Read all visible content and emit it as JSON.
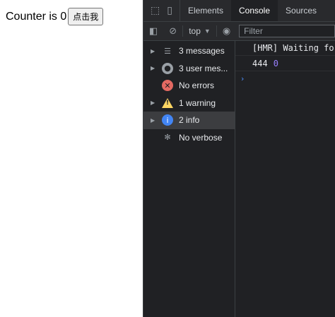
{
  "app": {
    "counter_text": "Counter is 0",
    "button_label": "点击我"
  },
  "devtools": {
    "tabs": [
      {
        "label": "Elements"
      },
      {
        "label": "Console"
      },
      {
        "label": "Sources"
      }
    ],
    "toolbar": {
      "context_label": "top",
      "filter_placeholder": "Filter"
    },
    "sidebar": {
      "items": [
        {
          "label": "3 messages",
          "icon": "list-icon"
        },
        {
          "label": "3 user mes...",
          "icon": "user-icon"
        },
        {
          "label": "No errors",
          "icon": "error-icon"
        },
        {
          "label": "1 warning",
          "icon": "warning-icon"
        },
        {
          "label": "2 info",
          "icon": "info-icon"
        },
        {
          "label": "No verbose",
          "icon": "bug-icon"
        }
      ]
    },
    "console": {
      "lines": [
        {
          "text": "[HMR] Waiting fo"
        },
        {
          "text": "444",
          "value": "0"
        }
      ]
    }
  },
  "colors": {
    "devtools_bg": "#202124",
    "info_blue": "#4285f4",
    "warning_yellow": "#fdd663",
    "error_red": "#e46962",
    "number_purple": "#9980ff"
  }
}
